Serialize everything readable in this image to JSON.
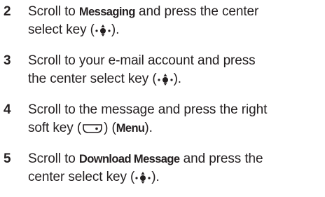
{
  "steps": [
    {
      "number": "2",
      "t1": "Scroll to ",
      "kw1": "Messaging",
      "t2": " and press the center",
      "t3": "select key (",
      "t4": ")."
    },
    {
      "number": "3",
      "t1": "Scroll to your e-mail account and press",
      "t2": "the center select key (",
      "t3": ")."
    },
    {
      "number": "4",
      "t1": "Scroll to the message and press the right",
      "t2": "soft key (",
      "t3": ") (",
      "kw1": "Menu",
      "t4": ")."
    },
    {
      "number": "5",
      "t1": "Scroll to ",
      "kw1": "Download Message",
      "t2": " and press the",
      "t3": "center select key (",
      "t4": ")."
    }
  ],
  "icons": {
    "center_select": "center-select-key-icon",
    "right_soft_key": "right-soft-key-icon"
  }
}
